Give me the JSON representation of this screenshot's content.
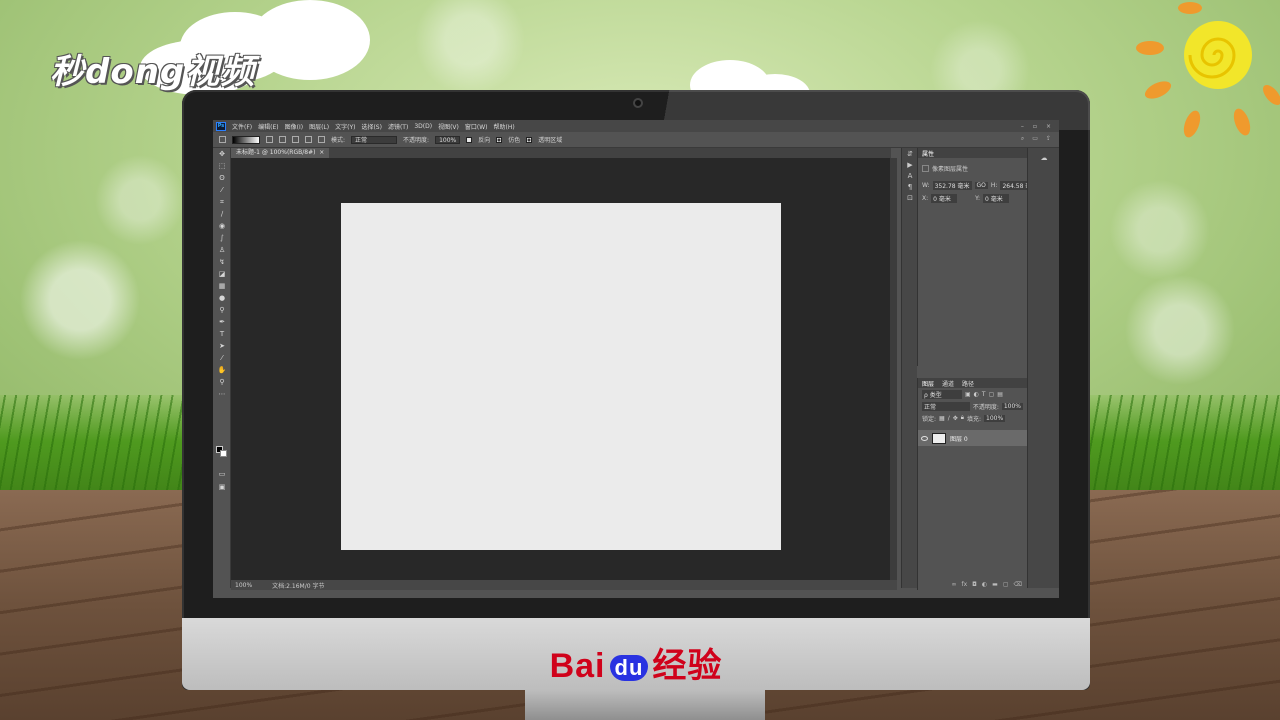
{
  "watermark": {
    "brand_text": "秒dong视频",
    "baidu_bai": "Bai",
    "baidu_du": "du",
    "baidu_suffix": "经验"
  },
  "app": {
    "logo": "Ps",
    "menu": [
      "文件(F)",
      "编辑(E)",
      "图像(I)",
      "图层(L)",
      "文字(Y)",
      "选择(S)",
      "滤镜(T)",
      "3D(D)",
      "视图(V)",
      "窗口(W)",
      "帮助(H)"
    ],
    "window_controls": [
      "–",
      "▫",
      "×"
    ]
  },
  "options_bar": {
    "mode_label": "模式:",
    "mode_value": "正常",
    "opacity_label": "不透明度:",
    "opacity_value": "100%",
    "reverse_label": "反向",
    "dither_label": "仿色",
    "transparency_label": "透明区域"
  },
  "document": {
    "tab_title": "未标题-1 @ 100%(RGB/8#)",
    "zoom": "100%",
    "doc_info": "文档:2.16M/0 字节"
  },
  "properties": {
    "title": "属性",
    "subtitle": "像素图层属性",
    "w_label": "W:",
    "w_value": "352.78 毫米",
    "go_label": "GO",
    "h_label": "H:",
    "h_value": "264.58 毫米",
    "x_label": "X:",
    "x_value": "0 毫米",
    "y_label": "Y:",
    "y_value": "0 毫米"
  },
  "layers": {
    "tabs": [
      "图层",
      "通道",
      "路径"
    ],
    "filter_label": "ρ 类型",
    "blend_mode": "正常",
    "opacity_label": "不透明度:",
    "opacity_value": "100%",
    "lock_label": "锁定:",
    "fill_label": "填充:",
    "fill_value": "100%",
    "items": [
      {
        "name": "图层 0",
        "visible": true
      }
    ],
    "footer_icons": [
      "link-icon",
      "fx-icon",
      "mask-icon",
      "adjustment-icon",
      "folder-icon",
      "new-layer-icon",
      "trash-icon"
    ]
  },
  "colors": {
    "ps_dark": "#282828",
    "ps_panel": "#535353",
    "canvas": "#ebebeb",
    "baidu_red": "#d0021b",
    "baidu_blue": "#2932e1"
  }
}
